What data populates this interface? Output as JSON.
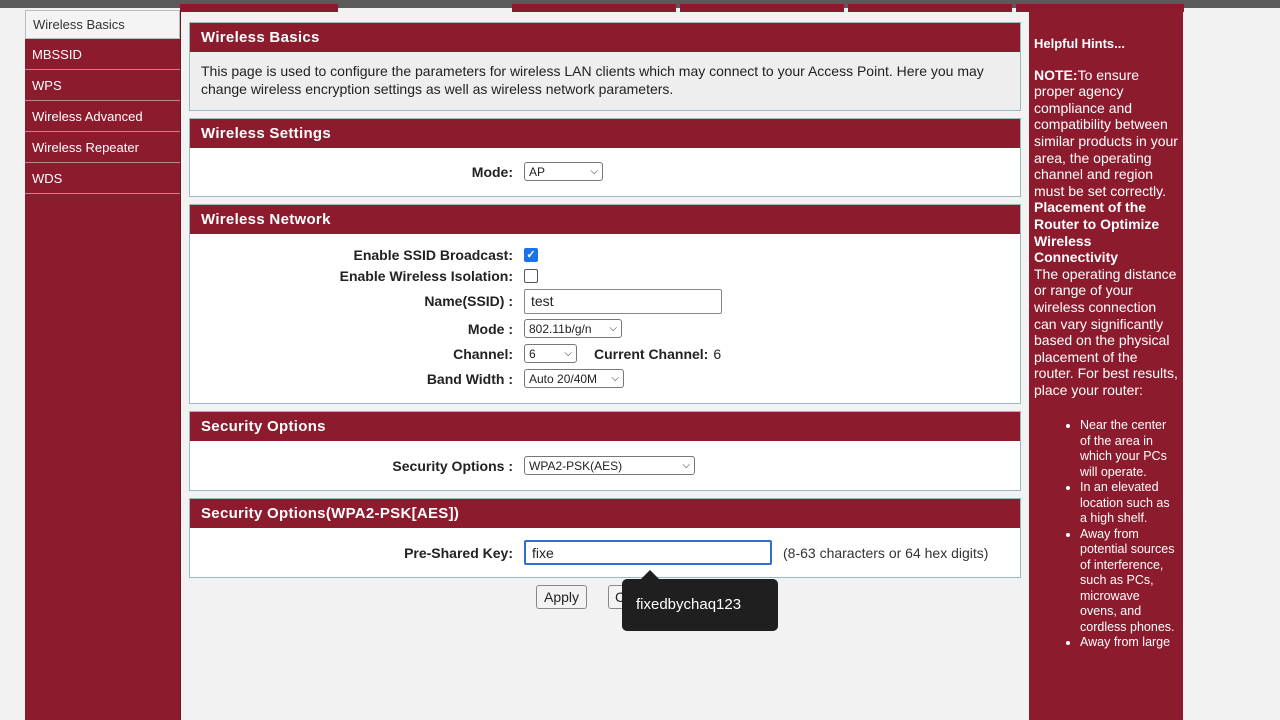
{
  "left_menu": [
    {
      "label": "Wireless Basics",
      "active": true
    },
    {
      "label": "MBSSID",
      "active": false
    },
    {
      "label": "WPS",
      "active": false
    },
    {
      "label": "Wireless Advanced",
      "active": false
    },
    {
      "label": "Wireless Repeater",
      "active": false
    },
    {
      "label": "WDS",
      "active": false
    }
  ],
  "basics": {
    "title": "Wireless Basics",
    "description": "This page is used to configure the parameters for wireless LAN clients which may connect to your Access Point. Here you may change wireless encryption settings as well as wireless network parameters."
  },
  "settings": {
    "title": "Wireless Settings",
    "mode_label": "Mode:",
    "mode_value": "AP"
  },
  "network": {
    "title": "Wireless Network",
    "ssid_broadcast_label": "Enable SSID Broadcast:",
    "ssid_broadcast_checked": true,
    "isolation_label": "Enable Wireless Isolation:",
    "isolation_checked": false,
    "name_label": "Name(SSID) :",
    "name_value": "test",
    "mode_label": "Mode :",
    "mode_value": "802.11b/g/n",
    "channel_label": "Channel:",
    "channel_value": "6",
    "current_channel_label": "Current Channel:",
    "current_channel_value": "6",
    "bandwidth_label": "Band Width :",
    "bandwidth_value": "Auto 20/40M"
  },
  "security": {
    "title": "Security Options",
    "label": "Security Options :",
    "value": "WPA2-PSK(AES)"
  },
  "psk": {
    "title": "Security Options(WPA2-PSK[AES])",
    "label": "Pre-Shared Key:",
    "value": "fixe",
    "hint": "(8-63 characters or 64 hex digits)"
  },
  "buttons": {
    "apply": "Apply",
    "cancel": "C"
  },
  "tooltip": {
    "text": "fixedbychaq123"
  },
  "hints": {
    "title": "Helpful Hints...",
    "note_label": "NOTE:",
    "note_text": "To ensure proper agency compliance and compatibility between similar products in your area, the operating channel and region must be set correctly.",
    "placement_title": "Placement of the Router to Optimize Wireless Connectivity",
    "placement_text": "The operating distance or range of your wireless connection can vary significantly based on the physical placement of the router. For best results, place your router:",
    "bullets": [
      "Near the center of the area in which your PCs will operate.",
      "In an elevated location such as a high shelf.",
      "Away from potential sources of interference, such as PCs, microwave ovens, and cordless phones.",
      "Away from large"
    ]
  },
  "colors": {
    "brand": "#8c1b2e",
    "focus": "#2f6fd6",
    "checkbox": "#1a73e8"
  }
}
